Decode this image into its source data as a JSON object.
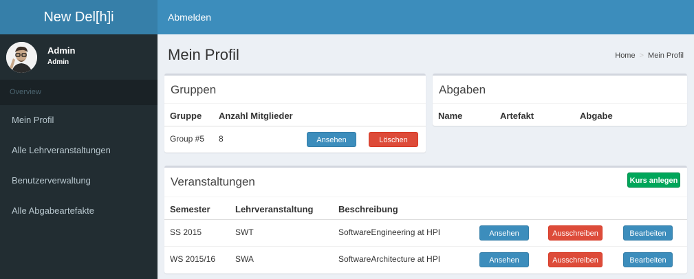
{
  "header": {
    "logo": "New Del[h]i",
    "logout": "Abmelden"
  },
  "sidebar": {
    "user": {
      "name": "Admin",
      "role": "Admin"
    },
    "section_header": "Overview",
    "items": [
      {
        "label": "Mein Profil"
      },
      {
        "label": "Alle Lehrveranstaltungen"
      },
      {
        "label": "Benutzerverwaltung"
      },
      {
        "label": "Alle Abgabeartefakte"
      }
    ]
  },
  "page": {
    "title": "Mein Profil",
    "breadcrumb": {
      "home": "Home",
      "separator": ">",
      "current": "Mein Profil"
    }
  },
  "groups": {
    "title": "Gruppen",
    "headers": [
      "Gruppe",
      "Anzahl Mitglieder"
    ],
    "rows": [
      {
        "group": "Group #5",
        "members": "8",
        "view": "Ansehen",
        "delete": "Löschen"
      }
    ]
  },
  "submissions": {
    "title": "Abgaben",
    "headers": [
      "Name",
      "Artefakt",
      "Abgabe"
    ]
  },
  "courses": {
    "title": "Veranstaltungen",
    "create_button": "Kurs anlegen",
    "headers": [
      "Semester",
      "Lehrveranstaltung",
      "Beschreibung"
    ],
    "rows": [
      {
        "semester": "SS 2015",
        "course": "SWT",
        "description": "SoftwareEngineering at HPI",
        "view": "Ansehen",
        "unenroll": "Ausschreiben",
        "edit": "Bearbeiten"
      },
      {
        "semester": "WS 2015/16",
        "course": "SWA",
        "description": "SoftwareArchitecture at HPI",
        "view": "Ansehen",
        "unenroll": "Ausschreiben",
        "edit": "Bearbeiten"
      }
    ]
  },
  "colors": {
    "header": "#3c8dbc",
    "logo_bg": "#367fa9",
    "sidebar": "#222d32",
    "primary": "#3c8dbc",
    "danger": "#dd4b39",
    "success": "#00a65a"
  }
}
